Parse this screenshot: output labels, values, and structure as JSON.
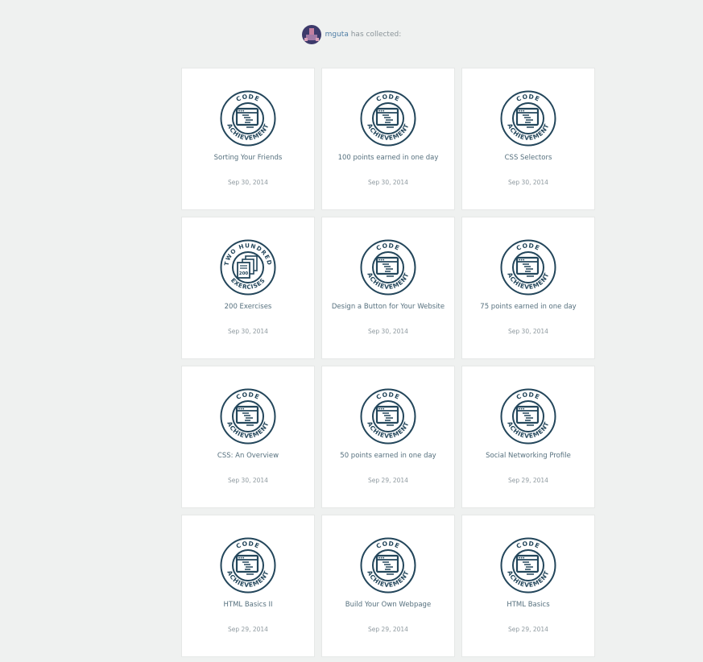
{
  "collector": {
    "username": "mguta",
    "suffix": "has collected:"
  },
  "colors": {
    "background": "#eff1f0",
    "badge": "#23465b",
    "username": "#4e7da5"
  },
  "achievements": [
    {
      "title": "Sorting Your Friends",
      "date": "Sep 30, 2014",
      "badge_top": "CODE",
      "badge_bottom": "ACHIEVEMENT",
      "icon": "code-window-icon"
    },
    {
      "title": "100 points earned in one day",
      "date": "Sep 30, 2014",
      "badge_top": "CODE",
      "badge_bottom": "ACHIEVEMENT",
      "icon": "code-window-icon"
    },
    {
      "title": "CSS Selectors",
      "date": "Sep 30, 2014",
      "badge_top": "CODE",
      "badge_bottom": "ACHIEVEMENT",
      "icon": "code-window-icon"
    },
    {
      "title": "200 Exercises",
      "date": "Sep 30, 2014",
      "badge_top": "TWO HUNDRED",
      "badge_bottom": "EXERCISES",
      "badge_number": "200",
      "icon": "stacked-pages-icon"
    },
    {
      "title": "Design a Button for Your Website",
      "date": "Sep 30, 2014",
      "badge_top": "CODE",
      "badge_bottom": "ACHIEVEMENT",
      "icon": "code-window-icon"
    },
    {
      "title": "75 points earned in one day",
      "date": "Sep 30, 2014",
      "badge_top": "CODE",
      "badge_bottom": "ACHIEVEMENT",
      "icon": "code-window-icon"
    },
    {
      "title": "CSS: An Overview",
      "date": "Sep 30, 2014",
      "badge_top": "CODE",
      "badge_bottom": "ACHIEVEMENT",
      "icon": "code-window-icon"
    },
    {
      "title": "50 points earned in one day",
      "date": "Sep 29, 2014",
      "badge_top": "CODE",
      "badge_bottom": "ACHIEVEMENT",
      "icon": "code-window-icon"
    },
    {
      "title": "Social Networking Profile",
      "date": "Sep 29, 2014",
      "badge_top": "CODE",
      "badge_bottom": "ACHIEVEMENT",
      "icon": "code-window-icon"
    },
    {
      "title": "HTML Basics II",
      "date": "Sep 29, 2014",
      "badge_top": "CODE",
      "badge_bottom": "ACHIEVEMENT",
      "icon": "code-window-icon"
    },
    {
      "title": "Build Your Own Webpage",
      "date": "Sep 29, 2014",
      "badge_top": "CODE",
      "badge_bottom": "ACHIEVEMENT",
      "icon": "code-window-icon"
    },
    {
      "title": "HTML Basics",
      "date": "Sep 29, 2014",
      "badge_top": "CODE",
      "badge_bottom": "ACHIEVEMENT",
      "icon": "code-window-icon"
    }
  ]
}
